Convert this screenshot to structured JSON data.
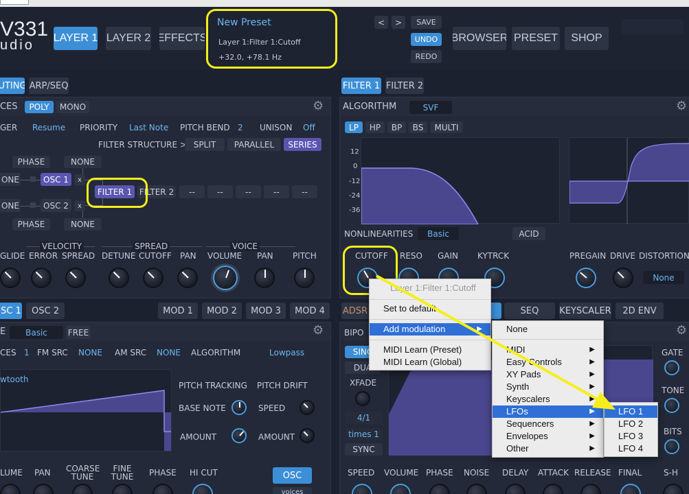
{
  "brand": {
    "line1": "V331",
    "line2": "udio"
  },
  "top": {
    "layer1": "LAYER 1",
    "layer2": "LAYER 2",
    "effects": "EFFECTS",
    "preset_name": "New Preset",
    "param_path": "Layer 1:Filter 1:Cutoff",
    "param_value": "+32.0, +78.1 Hz",
    "prev": "<",
    "next": ">",
    "save": "SAVE",
    "undo": "UNDO",
    "redo": "REDO",
    "browser": "BROWSER",
    "preset": "PRESET",
    "shop": "SHOP"
  },
  "left": {
    "tabs": [
      "UTING",
      "ARP/SEQ"
    ],
    "voices": {
      "title": "CES",
      "poly": "POLY",
      "mono": "MONO"
    },
    "row1": {
      "trigger": "GER",
      "trigger_val": "Resume",
      "priority": "PRIORITY",
      "priority_val": "Last Note",
      "pitchbend": "PITCH BEND",
      "pitchbend_val": "2",
      "unison": "UNISON",
      "unison_val": "Off"
    },
    "structure": {
      "label": "FILTER STRUCTURE >",
      "split": "SPLIT",
      "parallel": "PARALLEL",
      "series": "SERIES"
    },
    "routing": {
      "phase_top": "PHASE",
      "none_top": "NONE",
      "none_l1": "ONE",
      "osc1": "OSC 1",
      "x1": "x",
      "none_l2": "ONE",
      "osc2": "OSC 2",
      "x2": "x",
      "phase_bot": "PHASE",
      "none_bot": "NONE",
      "filter1": "FILTER 1",
      "filter2": "FILTER 2",
      "slots": [
        "--",
        "--",
        "--",
        "--",
        "--"
      ]
    },
    "groups": {
      "velocity": "VELOCITY",
      "spread": "SPREAD",
      "voice": "VOICE"
    },
    "knobs": [
      "GLIDE",
      "ERROR",
      "SPREAD",
      "DETUNE",
      "CUTOFF",
      "PAN",
      "VOLUME",
      "PAN",
      "PITCH"
    ],
    "osc_tabs": [
      "SC 1",
      "OSC 2"
    ],
    "mod_tabs": [
      "MOD 1",
      "MOD 2",
      "MOD 3",
      "MOD 4"
    ],
    "osc": {
      "title": "E",
      "mode": "Basic",
      "free": "FREE",
      "voices": "CES",
      "voices_val": "1",
      "fm_src": "FM SRC",
      "fm_src_val": "NONE",
      "am_src": "AM SRC",
      "am_src_val": "NONE",
      "algorithm": "ALGORITHM",
      "algorithm_val": "Lowpass",
      "wave": "wtooth",
      "pitch_tracking": "PITCH TRACKING",
      "pitch_drift": "PITCH DRIFT",
      "base_note": "BASE NOTE",
      "speed": "SPEED",
      "amount1": "AMOUNT",
      "amount2": "AMOUNT"
    },
    "bottom_knobs": [
      "LUME",
      "PAN",
      "COARSE TUNE",
      "FINE TUNE",
      "PHASE",
      "HI CUT"
    ],
    "osc_btn": "OSC",
    "voices_btn": "voices"
  },
  "right": {
    "tabs": [
      "FILTER 1",
      "FILTER 2"
    ],
    "algorithm": "ALGORITHM",
    "algorithm_val": "SVF",
    "types": [
      "LP",
      "HP",
      "BP",
      "BS",
      "MULTI"
    ],
    "db_labels": [
      "12",
      "0",
      "-12",
      "-24",
      "-36"
    ],
    "nonlin": "NONLINEARITIES",
    "nonlin_val": "Basic",
    "acid": "ACID",
    "knobs": [
      "CUTOFF",
      "RESO",
      "GAIN",
      "KYTRCK",
      "PREGAIN",
      "DRIVE",
      "DISTORTION"
    ],
    "distortion_val": "None",
    "mod_tabs": [
      "ADSR",
      "SEQ",
      "KEYSCALER",
      "2D ENV"
    ],
    "bipolar": "BIPO",
    "env": {
      "sinc": "SINC",
      "dual": "DUA",
      "xfade": "XFADE",
      "ratio": "4/1",
      "times": "times 1",
      "sync": "SYNC",
      "gate": "GATE",
      "tone": "TONE",
      "bits": "BITS"
    },
    "bottom_knobs": [
      "SPEED",
      "VOLUME",
      "PHASE",
      "NOISE",
      "DELAY",
      "ATTACK",
      "RELEASE",
      "FINAL",
      "S-H"
    ]
  },
  "context_menu": {
    "header": "Layer 1:Filter 1:Cutoff",
    "items": [
      "Set to default",
      "Add modulation",
      "MIDI Learn (Preset)",
      "MIDI Learn (Global)"
    ]
  },
  "submenu": {
    "items": [
      "None",
      "MIDI",
      "Easy Controls",
      "XY Pads",
      "Synth",
      "Keyscalers",
      "LFOs",
      "Sequencers",
      "Envelopes",
      "Other"
    ]
  },
  "lfo_menu": {
    "items": [
      "LFO 1",
      "LFO 2",
      "LFO 3",
      "LFO 4"
    ]
  },
  "colors": {
    "accent": "#3c8fd6",
    "highlight": "#f6ee1c",
    "filter_fill": "#4b478f",
    "menu_select": "#2f6fd6"
  }
}
